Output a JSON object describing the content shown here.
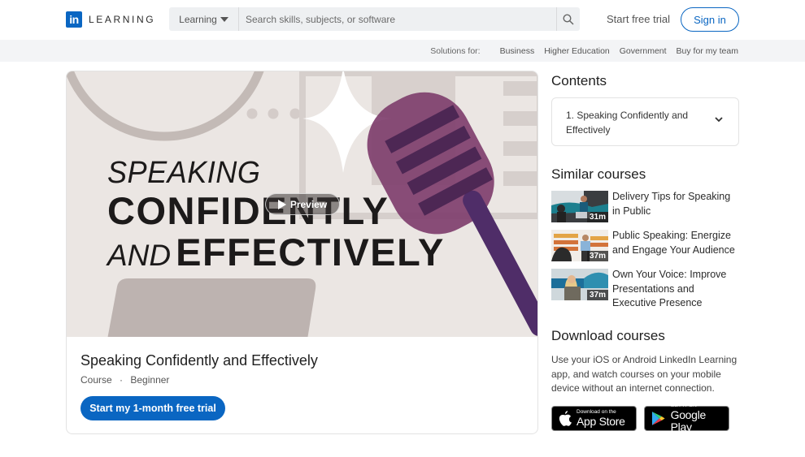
{
  "header": {
    "logo_mark": "in",
    "logo_text": "LEARNING",
    "search_scope": "Learning",
    "search_placeholder": "Search skills, subjects, or software",
    "search_value": "",
    "start_trial_label": "Start free trial",
    "sign_in_label": "Sign in",
    "brand_color": "#0a66c2"
  },
  "subnav": {
    "label": "Solutions for:",
    "links": [
      "Business",
      "Higher Education",
      "Government",
      "Buy for my team"
    ]
  },
  "hero": {
    "line1": "SPEAKING",
    "line2": "CONFIDENTLY",
    "line3a": "AND",
    "line3b": "EFFECTIVELY",
    "preview_label": "Preview",
    "icons": [
      "play-icon",
      "microphone-illustration",
      "sparkle-icon"
    ]
  },
  "course": {
    "title": "Speaking Confidently and Effectively",
    "type": "Course",
    "separator": "·",
    "level": "Beginner",
    "cta_label": "Start my 1-month free trial"
  },
  "contents": {
    "heading": "Contents",
    "items": [
      {
        "label": "1. Speaking Confidently and Effectively"
      }
    ]
  },
  "similar": {
    "heading": "Similar courses",
    "items": [
      {
        "title": "Delivery Tips for Speaking in Public",
        "duration": "31m"
      },
      {
        "title": "Public Speaking: Energize and Engage Your Audience",
        "duration": "37m"
      },
      {
        "title": "Own Your Voice: Improve Presentations and Executive Presence",
        "duration": "37m"
      }
    ]
  },
  "download": {
    "heading": "Download courses",
    "text": "Use your iOS or Android LinkedIn Learning app, and watch courses on your mobile device without an internet connection.",
    "app_store_small": "Download on the",
    "app_store_big": "App Store",
    "google_small": "GET IT ON",
    "google_big": "Google Play"
  }
}
